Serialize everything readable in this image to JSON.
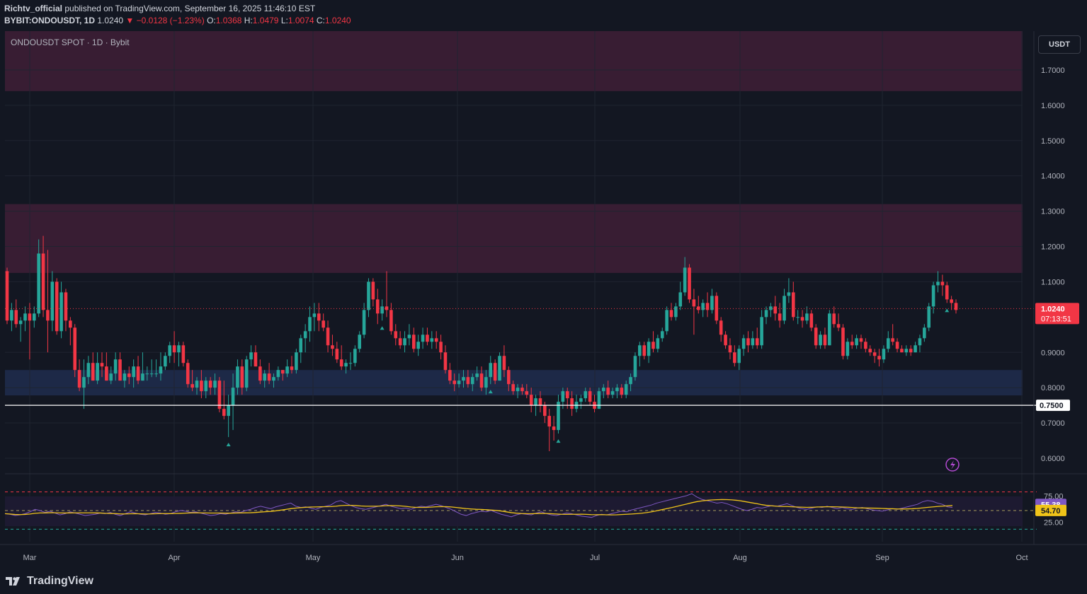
{
  "header": {
    "author": "Richtv_official",
    "published_text": " published on TradingView.com, September 16, 2025 11:46:10 EST",
    "symbol": "BYBIT:ONDOUSDT, 1D",
    "last": "1.0240",
    "change": "−0.0128 (−1.23%)",
    "o_label": "O:",
    "o": "1.0368",
    "h_label": "H:",
    "h": "1.0479",
    "l_label": "L:",
    "l": "1.0074",
    "c_label": "C:",
    "c": "1.0240"
  },
  "pane_label": "ONDOUSDT SPOT · 1D · Bybit",
  "currency_button": "USDT",
  "price_badge": {
    "value": "1.0240",
    "countdown": "07:13:51"
  },
  "level_badge": "0.7500",
  "rsi_badges": {
    "rsi": "55.38",
    "ma": "54.70"
  },
  "footer": {
    "brand": "TradingView"
  },
  "colors": {
    "up": "#26a69a",
    "down": "#f23645",
    "zone": "#3a1d35",
    "support_zone": "#1e2a4a",
    "rsi": "#7e57c2",
    "rsi_ma": "#f0c419",
    "background": "#131722"
  },
  "chart_data": {
    "type": "candlestick",
    "price_axis": {
      "ticks": [
        "1.7000",
        "1.6000",
        "1.5000",
        "1.4000",
        "1.3000",
        "1.2000",
        "1.1000",
        "0.9000",
        "0.8000",
        "0.7000",
        "0.6000"
      ],
      "range": [
        0.56,
        1.81
      ]
    },
    "time_axis": {
      "ticks": [
        "Mar",
        "Apr",
        "May",
        "Jun",
        "Jul",
        "Aug",
        "Sep",
        "Oct"
      ]
    },
    "zones": [
      {
        "type": "resistance",
        "from": 1.64,
        "to": 1.81
      },
      {
        "type": "resistance",
        "from": 1.125,
        "to": 1.32
      },
      {
        "type": "support",
        "from": 0.778,
        "to": 0.85
      }
    ],
    "horizontal_line": 0.75,
    "current_price": 1.024,
    "candles": [
      [
        1.13,
        1.14,
        0.98,
        0.99
      ],
      [
        0.99,
        1.04,
        0.96,
        1.02
      ],
      [
        1.02,
        1.05,
        0.97,
        0.98
      ],
      [
        0.98,
        1.0,
        0.93,
        0.99
      ],
      [
        0.99,
        1.03,
        0.96,
        1.01
      ],
      [
        1.01,
        1.04,
        0.88,
        0.99
      ],
      [
        0.99,
        1.03,
        0.97,
        1.01
      ],
      [
        1.01,
        1.22,
        1.0,
        1.18
      ],
      [
        1.18,
        1.23,
        1.0,
        1.02
      ],
      [
        1.02,
        1.19,
        0.9,
        0.99
      ],
      [
        0.99,
        1.13,
        0.96,
        1.1
      ],
      [
        1.1,
        1.11,
        0.95,
        0.96
      ],
      [
        0.96,
        1.1,
        0.94,
        1.07
      ],
      [
        1.07,
        1.08,
        0.96,
        0.99
      ],
      [
        0.99,
        1.0,
        0.92,
        0.97
      ],
      [
        0.97,
        0.98,
        0.83,
        0.85
      ],
      [
        0.85,
        0.88,
        0.79,
        0.8
      ],
      [
        0.8,
        0.88,
        0.74,
        0.83
      ],
      [
        0.83,
        0.89,
        0.81,
        0.87
      ],
      [
        0.87,
        0.9,
        0.82,
        0.82
      ],
      [
        0.82,
        0.9,
        0.81,
        0.87
      ],
      [
        0.87,
        0.9,
        0.83,
        0.86
      ],
      [
        0.86,
        0.9,
        0.82,
        0.82
      ],
      [
        0.82,
        0.86,
        0.81,
        0.84
      ],
      [
        0.84,
        0.9,
        0.82,
        0.88
      ],
      [
        0.88,
        0.9,
        0.82,
        0.82
      ],
      [
        0.82,
        0.85,
        0.8,
        0.84
      ],
      [
        0.84,
        0.86,
        0.81,
        0.83
      ],
      [
        0.83,
        0.88,
        0.8,
        0.86
      ],
      [
        0.86,
        0.89,
        0.81,
        0.82
      ],
      [
        0.82,
        0.9,
        0.82,
        0.84
      ],
      [
        0.84,
        0.86,
        0.82,
        0.84
      ],
      [
        0.84,
        0.88,
        0.83,
        0.84
      ],
      [
        0.84,
        0.88,
        0.83,
        0.84
      ],
      [
        0.84,
        0.9,
        0.82,
        0.86
      ],
      [
        0.86,
        0.9,
        0.85,
        0.89
      ],
      [
        0.89,
        0.93,
        0.87,
        0.92
      ],
      [
        0.92,
        0.96,
        0.87,
        0.9
      ],
      [
        0.9,
        0.93,
        0.86,
        0.92
      ],
      [
        0.92,
        0.93,
        0.86,
        0.87
      ],
      [
        0.87,
        0.88,
        0.8,
        0.81
      ],
      [
        0.81,
        0.85,
        0.79,
        0.8
      ],
      [
        0.8,
        0.83,
        0.78,
        0.82
      ],
      [
        0.82,
        0.85,
        0.77,
        0.79
      ],
      [
        0.79,
        0.83,
        0.77,
        0.82
      ],
      [
        0.82,
        0.83,
        0.78,
        0.8
      ],
      [
        0.8,
        0.84,
        0.78,
        0.82
      ],
      [
        0.82,
        0.83,
        0.73,
        0.74
      ],
      [
        0.74,
        0.82,
        0.71,
        0.72
      ],
      [
        0.72,
        0.78,
        0.66,
        0.75
      ],
      [
        0.75,
        0.84,
        0.68,
        0.8
      ],
      [
        0.8,
        0.88,
        0.78,
        0.86
      ],
      [
        0.86,
        0.88,
        0.78,
        0.8
      ],
      [
        0.8,
        0.89,
        0.79,
        0.88
      ],
      [
        0.88,
        0.92,
        0.86,
        0.9
      ],
      [
        0.9,
        0.92,
        0.86,
        0.86
      ],
      [
        0.86,
        0.88,
        0.81,
        0.82
      ],
      [
        0.82,
        0.85,
        0.8,
        0.84
      ],
      [
        0.84,
        0.87,
        0.81,
        0.82
      ],
      [
        0.82,
        0.84,
        0.8,
        0.83
      ],
      [
        0.83,
        0.86,
        0.82,
        0.85
      ],
      [
        0.85,
        0.85,
        0.82,
        0.84
      ],
      [
        0.84,
        0.88,
        0.83,
        0.86
      ],
      [
        0.86,
        0.89,
        0.84,
        0.85
      ],
      [
        0.85,
        0.91,
        0.84,
        0.9
      ],
      [
        0.9,
        0.95,
        0.87,
        0.94
      ],
      [
        0.94,
        0.98,
        0.9,
        0.96
      ],
      [
        0.96,
        1.03,
        0.93,
        1.0
      ],
      [
        1.0,
        1.04,
        0.96,
        1.01
      ],
      [
        1.01,
        1.04,
        0.96,
        0.99
      ],
      [
        0.99,
        1.01,
        0.96,
        0.97
      ],
      [
        0.97,
        0.99,
        0.9,
        0.92
      ],
      [
        0.92,
        0.95,
        0.89,
        0.91
      ],
      [
        0.91,
        0.93,
        0.87,
        0.88
      ],
      [
        0.88,
        0.92,
        0.85,
        0.86
      ],
      [
        0.86,
        0.88,
        0.84,
        0.87
      ],
      [
        0.87,
        0.9,
        0.85,
        0.87
      ],
      [
        0.87,
        0.92,
        0.86,
        0.91
      ],
      [
        0.91,
        0.96,
        0.9,
        0.95
      ],
      [
        0.95,
        1.04,
        0.94,
        1.02
      ],
      [
        1.02,
        1.11,
        1.0,
        1.1
      ],
      [
        1.1,
        1.11,
        1.03,
        1.05
      ],
      [
        1.05,
        1.08,
        0.98,
        1.01
      ],
      [
        1.01,
        1.05,
        0.99,
        1.03
      ],
      [
        1.03,
        1.13,
        1.0,
        1.02
      ],
      [
        1.02,
        1.04,
        0.95,
        0.96
      ],
      [
        0.96,
        0.98,
        0.92,
        0.94
      ],
      [
        0.94,
        0.96,
        0.91,
        0.92
      ],
      [
        0.92,
        0.96,
        0.9,
        0.94
      ],
      [
        0.94,
        0.98,
        0.92,
        0.95
      ],
      [
        0.95,
        0.97,
        0.9,
        0.91
      ],
      [
        0.91,
        0.95,
        0.89,
        0.93
      ],
      [
        0.93,
        0.97,
        0.91,
        0.95
      ],
      [
        0.95,
        0.97,
        0.92,
        0.93
      ],
      [
        0.93,
        0.96,
        0.91,
        0.94
      ],
      [
        0.94,
        0.96,
        0.91,
        0.93
      ],
      [
        0.93,
        0.95,
        0.88,
        0.9
      ],
      [
        0.9,
        0.92,
        0.84,
        0.85
      ],
      [
        0.85,
        0.87,
        0.81,
        0.82
      ],
      [
        0.82,
        0.84,
        0.79,
        0.81
      ],
      [
        0.81,
        0.84,
        0.8,
        0.82
      ],
      [
        0.82,
        0.85,
        0.8,
        0.83
      ],
      [
        0.83,
        0.85,
        0.8,
        0.81
      ],
      [
        0.81,
        0.84,
        0.79,
        0.83
      ],
      [
        0.83,
        0.86,
        0.82,
        0.84
      ],
      [
        0.84,
        0.86,
        0.79,
        0.8
      ],
      [
        0.8,
        0.85,
        0.78,
        0.83
      ],
      [
        0.83,
        0.89,
        0.81,
        0.87
      ],
      [
        0.87,
        0.88,
        0.81,
        0.82
      ],
      [
        0.82,
        0.9,
        0.82,
        0.89
      ],
      [
        0.89,
        0.92,
        0.83,
        0.85
      ],
      [
        0.85,
        0.86,
        0.79,
        0.81
      ],
      [
        0.81,
        0.82,
        0.78,
        0.79
      ],
      [
        0.79,
        0.81,
        0.77,
        0.8
      ],
      [
        0.8,
        0.81,
        0.78,
        0.79
      ],
      [
        0.79,
        0.81,
        0.77,
        0.78
      ],
      [
        0.78,
        0.8,
        0.73,
        0.75
      ],
      [
        0.75,
        0.78,
        0.72,
        0.77
      ],
      [
        0.77,
        0.79,
        0.73,
        0.75
      ],
      [
        0.75,
        0.76,
        0.7,
        0.72
      ],
      [
        0.72,
        0.74,
        0.62,
        0.69
      ],
      [
        0.69,
        0.72,
        0.65,
        0.68
      ],
      [
        0.68,
        0.78,
        0.67,
        0.76
      ],
      [
        0.76,
        0.8,
        0.74,
        0.79
      ],
      [
        0.79,
        0.8,
        0.74,
        0.77
      ],
      [
        0.77,
        0.79,
        0.72,
        0.74
      ],
      [
        0.74,
        0.78,
        0.73,
        0.76
      ],
      [
        0.76,
        0.78,
        0.74,
        0.77
      ],
      [
        0.77,
        0.8,
        0.76,
        0.79
      ],
      [
        0.79,
        0.8,
        0.75,
        0.76
      ],
      [
        0.76,
        0.78,
        0.73,
        0.74
      ],
      [
        0.74,
        0.8,
        0.74,
        0.79
      ],
      [
        0.79,
        0.81,
        0.77,
        0.8
      ],
      [
        0.8,
        0.82,
        0.77,
        0.78
      ],
      [
        0.78,
        0.8,
        0.77,
        0.79
      ],
      [
        0.79,
        0.81,
        0.77,
        0.8
      ],
      [
        0.8,
        0.81,
        0.77,
        0.78
      ],
      [
        0.78,
        0.82,
        0.77,
        0.81
      ],
      [
        0.81,
        0.84,
        0.79,
        0.83
      ],
      [
        0.83,
        0.9,
        0.82,
        0.89
      ],
      [
        0.89,
        0.93,
        0.86,
        0.92
      ],
      [
        0.92,
        0.93,
        0.88,
        0.89
      ],
      [
        0.89,
        0.94,
        0.87,
        0.93
      ],
      [
        0.93,
        0.96,
        0.9,
        0.91
      ],
      [
        0.91,
        0.95,
        0.9,
        0.94
      ],
      [
        0.94,
        0.97,
        0.93,
        0.96
      ],
      [
        0.96,
        1.03,
        0.95,
        1.02
      ],
      [
        1.02,
        1.04,
        0.99,
        1.0
      ],
      [
        1.0,
        1.04,
        0.99,
        1.03
      ],
      [
        1.03,
        1.1,
        1.02,
        1.07
      ],
      [
        1.07,
        1.17,
        1.06,
        1.14
      ],
      [
        1.14,
        1.15,
        1.04,
        1.05
      ],
      [
        1.05,
        1.08,
        0.95,
        1.03
      ],
      [
        1.03,
        1.06,
        1.01,
        1.02
      ],
      [
        1.02,
        1.05,
        1.0,
        1.04
      ],
      [
        1.04,
        1.07,
        1.0,
        1.02
      ],
      [
        1.02,
        1.08,
        1.01,
        1.06
      ],
      [
        1.06,
        1.07,
        0.98,
        0.99
      ],
      [
        0.99,
        1.0,
        0.93,
        0.95
      ],
      [
        0.95,
        0.96,
        0.91,
        0.92
      ],
      [
        0.92,
        0.94,
        0.88,
        0.9
      ],
      [
        0.9,
        0.92,
        0.86,
        0.87
      ],
      [
        0.87,
        0.92,
        0.85,
        0.91
      ],
      [
        0.91,
        0.95,
        0.89,
        0.94
      ],
      [
        0.94,
        0.96,
        0.9,
        0.92
      ],
      [
        0.92,
        0.96,
        0.91,
        0.94
      ],
      [
        0.94,
        0.97,
        0.91,
        0.92
      ],
      [
        0.92,
        1.02,
        0.91,
        1.0
      ],
      [
        1.0,
        1.03,
        0.98,
        1.02
      ],
      [
        1.02,
        1.04,
        1.0,
        1.03
      ],
      [
        1.03,
        1.06,
        0.99,
        1.01
      ],
      [
        1.01,
        1.04,
        0.97,
        0.99
      ],
      [
        0.99,
        1.08,
        0.98,
        1.06
      ],
      [
        1.06,
        1.11,
        1.04,
        1.07
      ],
      [
        1.07,
        1.1,
        0.99,
        1.0
      ],
      [
        1.0,
        1.02,
        0.98,
        1.0
      ],
      [
        1.0,
        1.02,
        0.97,
        0.99
      ],
      [
        0.99,
        1.03,
        0.98,
        1.01
      ],
      [
        1.01,
        1.02,
        0.96,
        0.97
      ],
      [
        0.97,
        0.98,
        0.91,
        0.92
      ],
      [
        0.92,
        0.96,
        0.91,
        0.95
      ],
      [
        0.95,
        0.97,
        0.91,
        0.92
      ],
      [
        0.92,
        1.02,
        0.92,
        1.01
      ],
      [
        1.01,
        1.03,
        0.97,
        0.98
      ],
      [
        0.98,
        1.01,
        0.96,
        0.97
      ],
      [
        0.97,
        0.98,
        0.88,
        0.89
      ],
      [
        0.89,
        0.94,
        0.88,
        0.93
      ],
      [
        0.93,
        0.95,
        0.91,
        0.92
      ],
      [
        0.92,
        0.95,
        0.91,
        0.94
      ],
      [
        0.94,
        0.95,
        0.91,
        0.93
      ],
      [
        0.93,
        0.94,
        0.9,
        0.91
      ],
      [
        0.91,
        0.92,
        0.89,
        0.9
      ],
      [
        0.9,
        0.91,
        0.87,
        0.89
      ],
      [
        0.89,
        0.91,
        0.86,
        0.88
      ],
      [
        0.88,
        0.92,
        0.87,
        0.91
      ],
      [
        0.91,
        0.96,
        0.9,
        0.94
      ],
      [
        0.94,
        0.98,
        0.92,
        0.93
      ],
      [
        0.93,
        0.94,
        0.9,
        0.91
      ],
      [
        0.91,
        0.92,
        0.9,
        0.9
      ],
      [
        0.9,
        0.92,
        0.89,
        0.91
      ],
      [
        0.91,
        0.92,
        0.89,
        0.9
      ],
      [
        0.9,
        0.93,
        0.9,
        0.92
      ],
      [
        0.92,
        0.95,
        0.9,
        0.94
      ],
      [
        0.94,
        0.98,
        0.93,
        0.97
      ],
      [
        0.97,
        1.04,
        0.96,
        1.03
      ],
      [
        1.03,
        1.1,
        1.01,
        1.09
      ],
      [
        1.09,
        1.13,
        1.07,
        1.1
      ],
      [
        1.1,
        1.12,
        1.06,
        1.09
      ],
      [
        1.09,
        1.1,
        1.04,
        1.05
      ],
      [
        1.05,
        1.06,
        1.02,
        1.04
      ],
      [
        1.04,
        1.05,
        1.01,
        1.02
      ]
    ],
    "signal_markers_up": [
      49,
      83,
      107,
      122,
      208
    ],
    "rsi": {
      "levels": [
        "75.00",
        "25.00"
      ],
      "values": [
        45,
        44,
        42,
        43,
        45,
        48,
        52,
        50,
        47,
        49,
        46,
        43,
        45,
        48,
        46,
        44,
        42,
        43,
        44,
        46,
        45,
        47,
        44,
        42,
        45,
        48,
        46,
        44,
        43,
        45,
        47,
        46,
        44,
        45,
        48,
        50,
        49,
        47,
        48,
        46,
        44,
        42,
        43,
        45,
        44,
        46,
        48,
        47,
        50,
        52,
        55,
        57,
        55,
        53,
        56,
        58,
        60,
        62,
        57,
        55,
        56,
        54,
        52,
        55,
        57,
        59,
        64,
        66,
        62,
        58,
        55,
        53,
        52,
        54,
        56,
        58,
        60,
        57,
        55,
        53,
        54,
        52,
        55,
        57,
        56,
        58,
        60,
        58,
        55,
        52,
        48,
        44,
        42,
        45,
        47,
        49,
        48,
        50,
        47,
        44,
        42,
        40,
        43,
        45,
        44,
        43,
        46,
        48,
        45,
        43,
        42,
        44,
        46,
        45,
        43,
        41,
        40,
        39,
        42,
        44,
        43,
        45,
        47,
        49,
        48,
        51,
        53,
        55,
        57,
        59,
        62,
        64,
        66,
        68,
        70,
        72,
        74,
        77,
        72,
        68,
        66,
        64,
        62,
        63,
        61,
        58,
        55,
        52,
        50,
        52,
        55,
        54,
        56,
        58,
        57,
        59,
        61,
        58,
        55,
        53,
        52,
        54,
        56,
        55,
        57,
        55,
        53,
        55,
        53,
        52,
        54,
        55,
        53,
        51,
        50,
        49,
        51,
        53,
        52,
        54,
        56,
        58,
        60,
        64,
        66,
        65,
        62,
        60,
        56,
        55
      ],
      "ma_current": 54.7,
      "rsi_current": 55.38
    }
  }
}
